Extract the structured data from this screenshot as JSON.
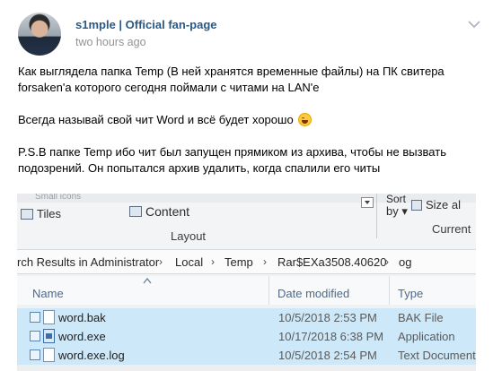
{
  "post": {
    "author": "s1mple | Official fan-page",
    "time": "two hours ago",
    "lines": [
      "Как выглядела папка Temp (В ней хранятся временные файлы) на ПК свитера",
      "forsaken'a которого сегодня поймали с читами на LAN'e",
      "Всегда называй свой чит Word и всё будет хорошо",
      "P.S.В папке Temp ибо чит был запущен прямиком из архива, чтобы не вызвать",
      "подозрений. Он попытался архив удалить, когда спалили его читы"
    ],
    "emoji": "grinning-sweat-emoji"
  },
  "photo": {
    "ribbon": {
      "small_icons": "Small icons",
      "tiles": "Tiles",
      "content": "Content",
      "layout": "Layout",
      "sort": "Sort",
      "by": "by",
      "size_all": "Size al",
      "current": "Current"
    },
    "address": {
      "search": "rch Results in Administrator",
      "local": "Local",
      "temp": "Temp",
      "rar": "Rar$EXa3508.40620",
      "og": "og"
    },
    "columns": {
      "name": "Name",
      "date": "Date modified",
      "type": "Type"
    },
    "files": [
      {
        "name": "word.bak",
        "date": "10/5/2018 2:53 PM",
        "type": "BAK File"
      },
      {
        "name": "word.exe",
        "date": "10/17/2018 6:38 PM",
        "type": "Application"
      },
      {
        "name": "word.exe.log",
        "date": "10/5/2018 2:54 PM",
        "type": "Text Document"
      }
    ]
  }
}
